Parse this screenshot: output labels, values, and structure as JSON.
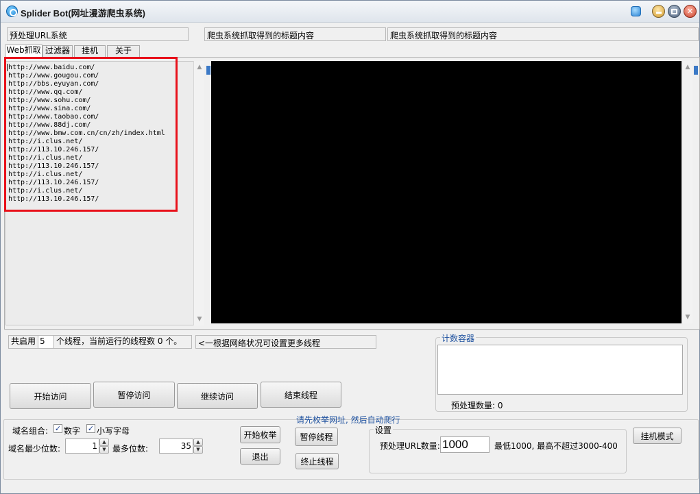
{
  "window": {
    "title": "Splider Bot(网址漫游爬虫系统)"
  },
  "top_fields": {
    "preprocess": "预处理URL系统",
    "title_a": "爬虫系统抓取得到的标题内容",
    "title_b": "爬虫系统抓取得到的标题内容"
  },
  "tabs": [
    {
      "label": "Web抓取",
      "active": true
    },
    {
      "label": "过滤器",
      "active": false
    },
    {
      "label": "挂机",
      "active": false
    },
    {
      "label": "关于",
      "active": false
    }
  ],
  "url_list": [
    "http://www.baidu.com/",
    "http://www.gougou.com/",
    "http://bbs.eyuyan.com/",
    "http://www.qq.com/",
    "http://www.sohu.com/",
    "http://www.sina.com/",
    "http://www.taobao.com/",
    "http://www.88dj.com/",
    "http://www.bmw.com.cn/cn/zh/index.html",
    "http://i.clus.net/",
    "http://113.10.246.157/",
    "http://i.clus.net/",
    "http://113.10.246.157/",
    "http://i.clus.net/",
    "http://113.10.246.157/",
    "http://i.clus.net/",
    "http://113.10.246.157/"
  ],
  "threads": {
    "prefix": "共启用",
    "count": "5",
    "suffix": "个线程，当前运行的线程数 0 个。",
    "hint": "<一根据网络状况可设置更多线程"
  },
  "buttons": {
    "start_visit": "开始访问",
    "pause_visit": "暂停访问",
    "resume_visit": "继续访问",
    "end_threads": "结束线程",
    "start_enum": "开始枚举",
    "exit": "退出",
    "pause_thread": "暂停线程",
    "stop_thread": "终止线程",
    "idle_mode": "挂机模式"
  },
  "counter": {
    "title": "计数容器",
    "preprocess_count": "预处理数量: 0"
  },
  "domain": {
    "combo_label": "域名组合:",
    "digits_label": "数字",
    "digits_checked": true,
    "lower_label": "小写字母",
    "lower_checked": true,
    "min_label": "域名最少位数:",
    "min_value": "1",
    "max_label": "最多位数:",
    "max_value": "35"
  },
  "notice": "请先枚举网址, 然后自动爬行",
  "settings": {
    "title": "设置",
    "url_count_label": "预处理URL数量:",
    "url_count_value": "1000",
    "limit_text": "最低1000, 最高不超过3000-400"
  },
  "colors": {
    "highlight_border": "#e8101a",
    "accent_blue": "#1b4f9e",
    "console_bg": "#000000"
  }
}
